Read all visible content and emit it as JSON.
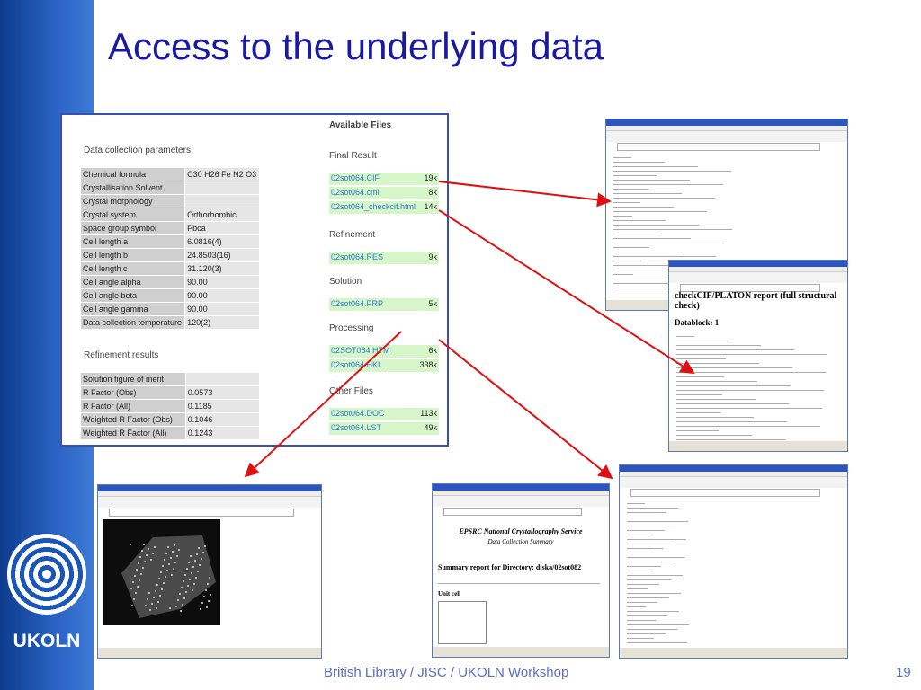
{
  "slide": {
    "title": "Access to the underlying data",
    "footer": "British Library / JISC / UKOLN Workshop",
    "page_number": "19",
    "logo_text": "UKOLN"
  },
  "panel": {
    "data_section_title": "Data collection parameters",
    "data_rows": [
      {
        "k": "Chemical formula",
        "v": "C30 H26 Fe N2 O3"
      },
      {
        "k": "Crystallisation Solvent",
        "v": ""
      },
      {
        "k": "Crystal morphology",
        "v": ""
      },
      {
        "k": "Crystal system",
        "v": "Orthorhombic"
      },
      {
        "k": "Space group symbol",
        "v": "Pbca"
      },
      {
        "k": "Cell length a",
        "v": "6.0816(4)"
      },
      {
        "k": "Cell length b",
        "v": "24.8503(16)"
      },
      {
        "k": "Cell length c",
        "v": "31.120(3)"
      },
      {
        "k": "Cell angle alpha",
        "v": "90.00"
      },
      {
        "k": "Cell angle beta",
        "v": "90.00"
      },
      {
        "k": "Cell angle gamma",
        "v": "90.00"
      },
      {
        "k": "Data collection temperature",
        "v": "120(2)"
      }
    ],
    "refine_section_title": "Refinement results",
    "refine_rows": [
      {
        "k": "Solution figure of merit",
        "v": ""
      },
      {
        "k": "R Factor (Obs)",
        "v": "0.0573"
      },
      {
        "k": "R Factor (All)",
        "v": "0.1185"
      },
      {
        "k": "Weighted R Factor (Obs)",
        "v": "0.1046"
      },
      {
        "k": "Weighted R Factor (All)",
        "v": "0.1243"
      }
    ],
    "files_title": "Available Files",
    "groups": [
      {
        "title": "Final Result",
        "files": [
          {
            "name": "02sot064.CIF",
            "size": "19k"
          },
          {
            "name": "02sot064.cml",
            "size": "8k"
          },
          {
            "name": "02sot064_checkcif.html",
            "size": "14k"
          }
        ]
      },
      {
        "title": "Refinement",
        "files": [
          {
            "name": "02sot064.RES",
            "size": "9k"
          }
        ]
      },
      {
        "title": "Solution",
        "files": [
          {
            "name": "02sot064.PRP",
            "size": "5k"
          }
        ]
      },
      {
        "title": "Processing",
        "files": [
          {
            "name": "02SOT064.HTM",
            "size": "6k"
          },
          {
            "name": "02sot064.HKL",
            "size": "338k"
          }
        ]
      },
      {
        "title": "Other Files",
        "files": [
          {
            "name": "02sot064.DOC",
            "size": "113k"
          },
          {
            "name": "02sot064.LST",
            "size": "49k"
          }
        ]
      }
    ]
  },
  "screens": {
    "platon_title": "checkCIF/PLATON report (full structural check)",
    "platon_datablock": "Datablock: 1",
    "epsrc_title": "EPSRC National Crystallography Service",
    "epsrc_subtitle": "Data Collection Summary",
    "epsrc_summary": "Summary report for Directory: diska/02sot082",
    "epsrc_unit_cell": "Unit cell"
  },
  "colors": {
    "title": "#1a1aa0",
    "arrow": "#e01010",
    "file_row_bg": "#d6f5c8",
    "file_link": "#2c7bd0",
    "panel_border": "#3b4fb0"
  }
}
